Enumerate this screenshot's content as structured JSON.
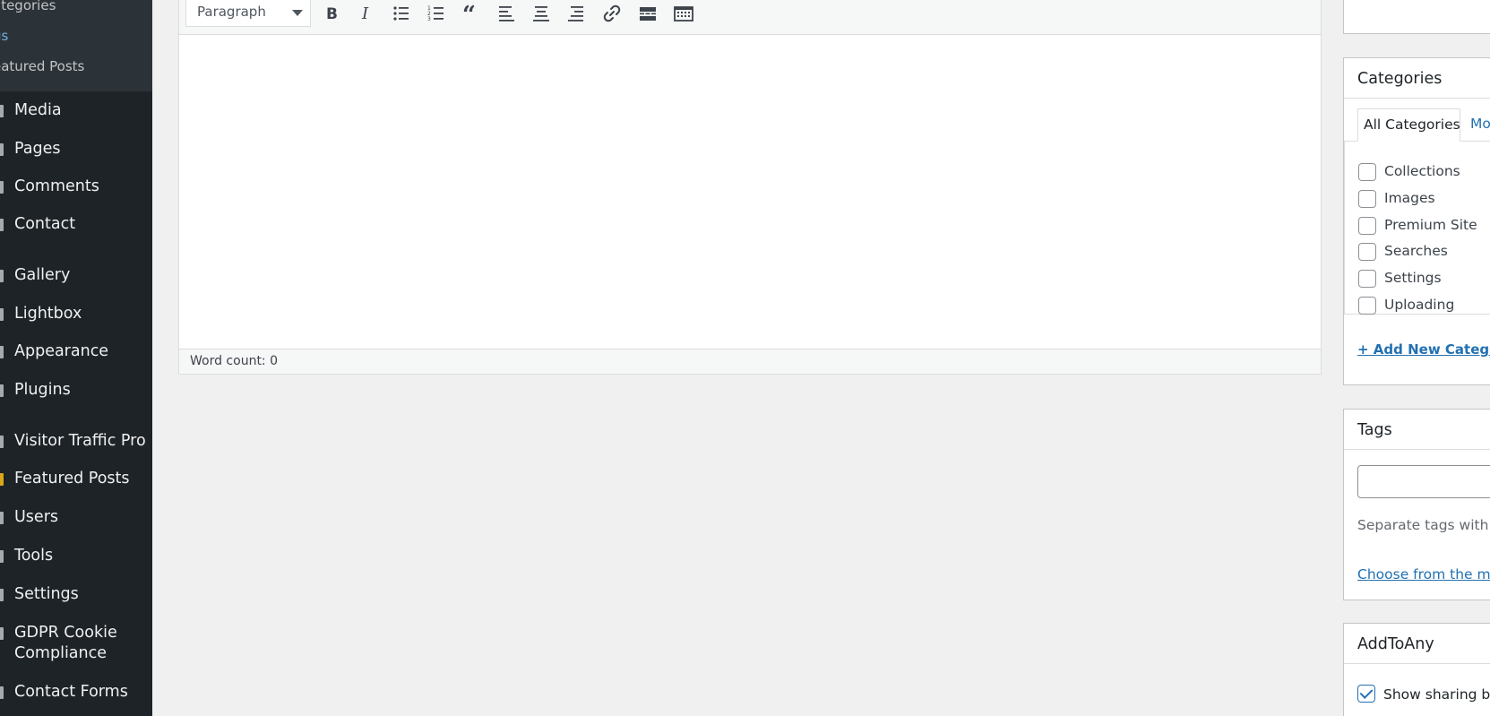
{
  "sidebar": {
    "submenu": [
      {
        "label": "ategories",
        "current": false
      },
      {
        "label": "gs",
        "current": true
      },
      {
        "label": "eatured Posts",
        "current": false
      }
    ],
    "menu": [
      {
        "label": "Media",
        "icon": "media-icon"
      },
      {
        "label": "Pages",
        "icon": "pages-icon"
      },
      {
        "label": "Comments",
        "icon": "comments-icon"
      },
      {
        "label": "Contact",
        "icon": "contact-icon"
      },
      {
        "label": "Gallery",
        "icon": "gallery-icon"
      },
      {
        "label": "Lightbox",
        "icon": "lightbox-icon"
      },
      {
        "label": "Appearance",
        "icon": "appearance-icon"
      },
      {
        "label": "Plugins",
        "icon": "plugins-icon"
      },
      {
        "label": "Visitor Traffic Pro",
        "icon": "chart-icon"
      },
      {
        "label": "Featured Posts",
        "icon": "star-icon"
      },
      {
        "label": "Users",
        "icon": "users-icon"
      },
      {
        "label": "Tools",
        "icon": "tools-icon"
      },
      {
        "label": "Settings",
        "icon": "settings-icon"
      },
      {
        "label": "GDPR Cookie Compliance",
        "icon": "shield-icon"
      },
      {
        "label": "Contact Forms",
        "icon": "forms-icon"
      }
    ]
  },
  "editor": {
    "format_select": "Paragraph",
    "toolbar_buttons": [
      "bold",
      "italic",
      "bulleted-list",
      "numbered-list",
      "blockquote",
      "align-left",
      "align-center",
      "align-right",
      "insert-link",
      "read-more",
      "toolbar-toggle"
    ],
    "word_count": "Word count: 0"
  },
  "categories": {
    "title": "Categories",
    "tab_all": "All Categories",
    "tab_most": "Mo",
    "items": [
      {
        "label": "Collections",
        "checked": false
      },
      {
        "label": "Images",
        "checked": false
      },
      {
        "label": "Premium Site",
        "checked": false
      },
      {
        "label": "Searches",
        "checked": false
      },
      {
        "label": "Settings",
        "checked": false
      },
      {
        "label": "Uploading",
        "checked": false
      }
    ],
    "add_new": "+ Add New Categor"
  },
  "tags": {
    "title": "Tags",
    "input_value": "",
    "help": "Separate tags with co",
    "choose_link": "Choose from the mo"
  },
  "addtoany": {
    "title": "AddToAny",
    "show_sharing_label": "Show sharing bu",
    "show_sharing_checked": true
  },
  "colors": {
    "sidebar_bg": "#1d2327",
    "submenu_bg": "#2c3338",
    "link": "#2271b1",
    "page_bg": "#f0f0f1"
  }
}
